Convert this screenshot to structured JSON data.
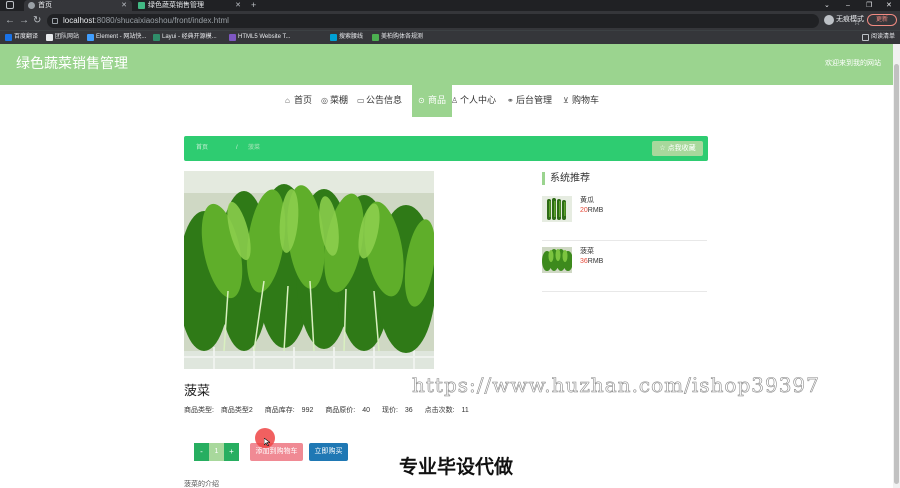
{
  "browser": {
    "tabs": [
      {
        "title": "首页"
      },
      {
        "title": "绿色蔬菜销售管理"
      }
    ],
    "new_tab": "+",
    "url_host": "localhost",
    "url_rest": ":8080/shucaixiaoshou/front/index.html",
    "profile": "无痕模式",
    "update": "更新",
    "bookmarks": [
      {
        "label": "百度翻译",
        "color": "#1a73e8"
      },
      {
        "label": "团队网站",
        "color": "#e8eaed"
      },
      {
        "label": "Element - 网站快...",
        "color": "#409eff"
      },
      {
        "label": "Layui - 经典开源模...",
        "color": "#2f8e6a"
      },
      {
        "label": "HTML5 Website T...",
        "color": "#7e57c2"
      },
      {
        "label": "搜索腰线",
        "color": "#00a1d6"
      },
      {
        "label": "美柏购体各规测",
        "color": "#4caf50"
      }
    ],
    "reading_list": "阅读清单"
  },
  "site": {
    "title": "绿色蔬菜销售管理",
    "welcome": "欢迎来到我的网站"
  },
  "nav": [
    {
      "label": "首页",
      "icon": "home-icon",
      "glyph": "⌂"
    },
    {
      "label": "菜棚",
      "icon": "leaf-icon",
      "glyph": "◎"
    },
    {
      "label": "公告信息",
      "icon": "notice-icon",
      "glyph": "▭"
    },
    {
      "label": "商品",
      "icon": "goods-icon",
      "glyph": "⊙",
      "active": true
    },
    {
      "label": "个人中心",
      "icon": "user-icon",
      "glyph": "♙"
    },
    {
      "label": "后台管理",
      "icon": "link-icon",
      "glyph": "⚭"
    },
    {
      "label": "购物车",
      "icon": "cart-icon",
      "glyph": "⊻"
    }
  ],
  "breadcrumb": {
    "first": "首页",
    "sep": "/",
    "current": "菠菜"
  },
  "favorite_button": "☆ 点我收藏",
  "product": {
    "name": "菠菜",
    "type_label": "商品类型:",
    "type_value": "商品类型2",
    "stock_label": "商品库存:",
    "stock_value": "992",
    "original_price_label": "商品原价:",
    "original_price_value": "40",
    "price_label": "现价:",
    "price_value": "36",
    "clicks_label": "点击次数:",
    "clicks_value": "11",
    "quantity": "1",
    "minus": "-",
    "plus": "+",
    "add_to_cart": "添加到购物车",
    "buy_now": "立即购买",
    "intro_label": "菠菜的介绍"
  },
  "recommend": {
    "title": "系统推荐",
    "items": [
      {
        "name": "黄瓜",
        "price": "20",
        "unit": "RMB"
      },
      {
        "name": "菠菜",
        "price": "36",
        "unit": "RMB"
      }
    ]
  },
  "overlay": {
    "watermark": "https://www.huzhan.com/ishop39397",
    "banner": "专业毕设代做"
  }
}
